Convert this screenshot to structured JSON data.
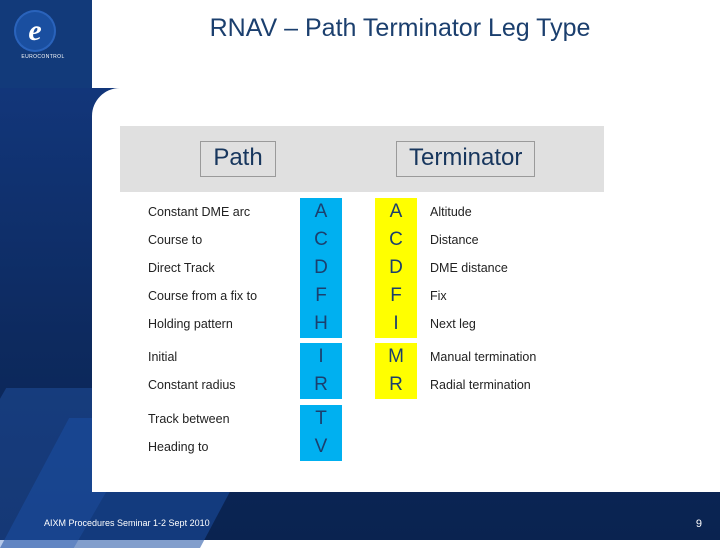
{
  "slide": {
    "title": "RNAV – Path Terminator Leg Type",
    "footer": "AIXM Procedures Seminar 1-2 Sept 2010",
    "page_number": "9"
  },
  "logo": {
    "letter": "e",
    "name": "EUROCONTROL"
  },
  "table": {
    "path_header": "Path",
    "terminator_header": "Terminator",
    "path_rows": [
      {
        "label": "Constant DME arc",
        "code": "A"
      },
      {
        "label": "Course to",
        "code": "C"
      },
      {
        "label": "Direct Track",
        "code": "D"
      },
      {
        "label": "Course from a fix to",
        "code": "F"
      },
      {
        "label": "Holding pattern",
        "code": "H"
      },
      {
        "label": "Initial",
        "code": "I"
      },
      {
        "label": "Constant radius",
        "code": "R"
      },
      {
        "label": "Track between",
        "code": "T"
      },
      {
        "label": "Heading to",
        "code": "V"
      }
    ],
    "terminator_rows": [
      {
        "code": "A",
        "label": "Altitude"
      },
      {
        "code": "C",
        "label": "Distance"
      },
      {
        "code": "D",
        "label": "DME distance"
      },
      {
        "code": "F",
        "label": "Fix"
      },
      {
        "code": "I",
        "label": "Next leg"
      },
      {
        "code": "M",
        "label": "Manual termination"
      },
      {
        "code": "R",
        "label": "Radial termination"
      }
    ]
  },
  "colors": {
    "path_code_bg": "#00b0f0",
    "terminator_code_bg": "#ffff00",
    "slide_blue": "#0f2f6b",
    "title_blue": "#1b3f6e",
    "header_grey": "#e0e0e0"
  }
}
